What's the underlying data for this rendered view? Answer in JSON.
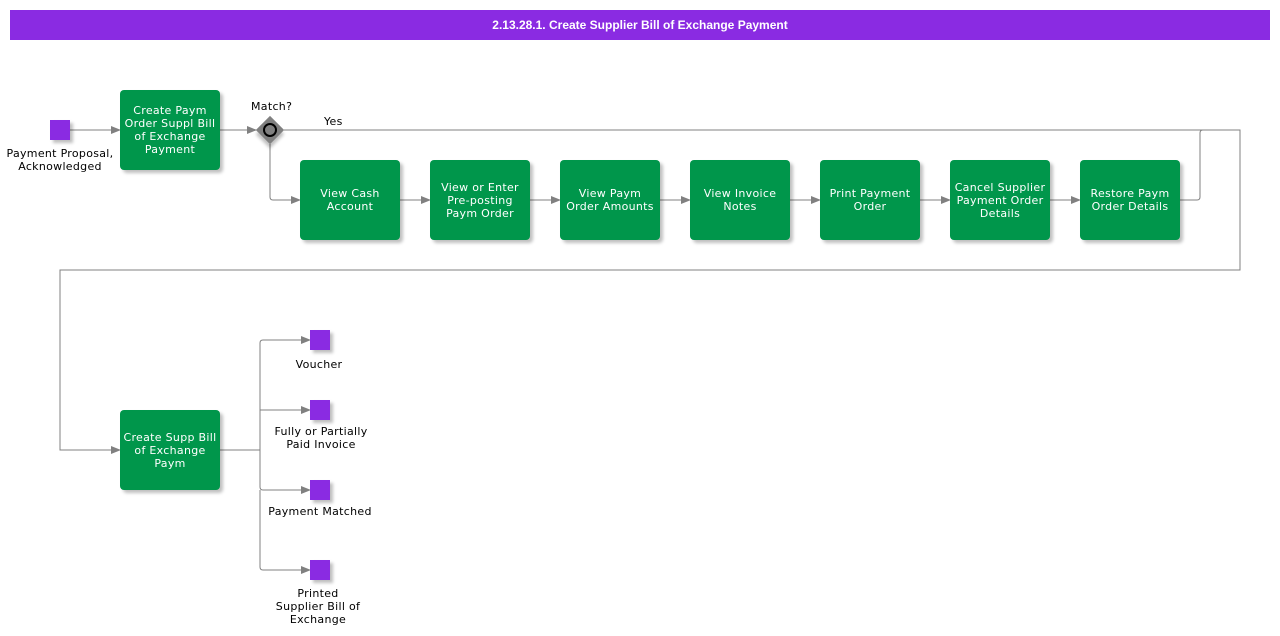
{
  "title": "2.13.28.1. Create Supplier Bill of Exchange Payment",
  "colors": {
    "header": "#8a2be2",
    "task": "#00964b",
    "event": "#8a2be2",
    "gateway": "#808080",
    "connector": "#808080"
  },
  "start_event": {
    "label": "Payment Proposal, Acknowledged",
    "icon": "start-event-icon"
  },
  "gateway": {
    "label": "Match?",
    "yes_label": "Yes",
    "icon": "gateway-icon"
  },
  "tasks": [
    {
      "id": "t1",
      "label": "Create Paym Order Suppl Bill of Exchange Payment"
    },
    {
      "id": "t2",
      "label": "View Cash Account"
    },
    {
      "id": "t3",
      "label": "View or Enter Pre-posting Paym Order"
    },
    {
      "id": "t4",
      "label": "View Paym Order Amounts"
    },
    {
      "id": "t5",
      "label": "View Invoice Notes"
    },
    {
      "id": "t6",
      "label": "Print Payment Order"
    },
    {
      "id": "t7",
      "label": "Cancel Supplier Payment Order Details"
    },
    {
      "id": "t8",
      "label": "Restore Paym Order Details"
    },
    {
      "id": "t9",
      "label": "Create Supp Bill of Exchange Paym"
    }
  ],
  "end_events": [
    {
      "label": "Voucher"
    },
    {
      "label": "Fully or Partially Paid Invoice"
    },
    {
      "label": "Payment Matched"
    },
    {
      "label": "Printed Supplier Bill of Exchange"
    }
  ]
}
